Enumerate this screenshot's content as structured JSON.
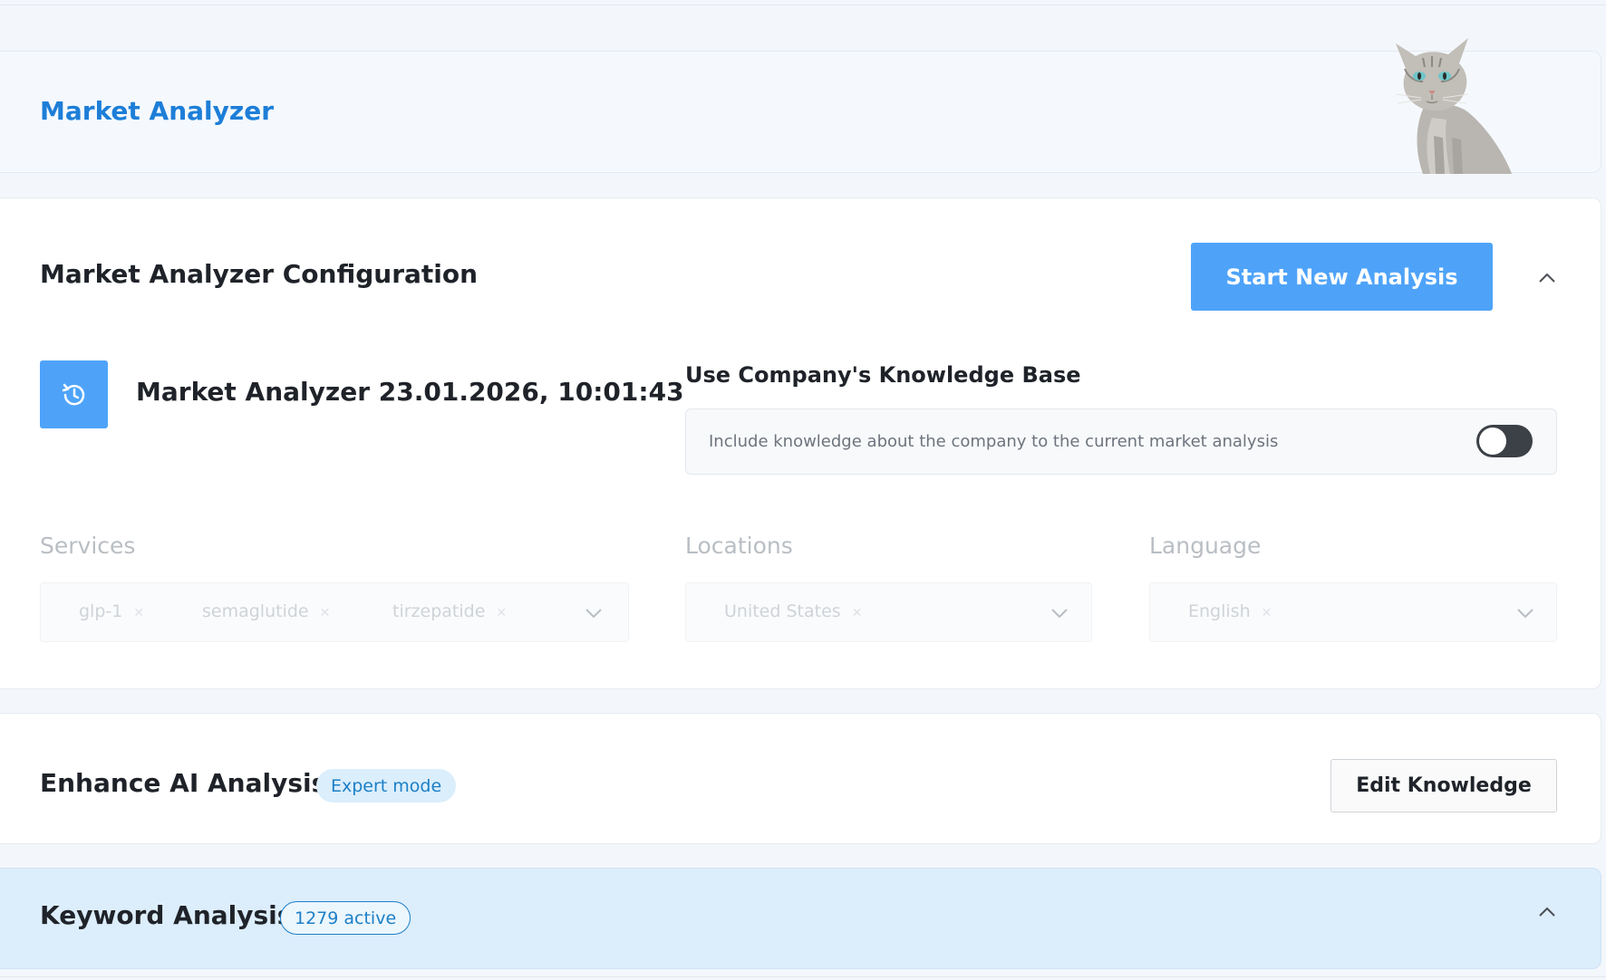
{
  "header": {
    "title": "Market Analyzer"
  },
  "config": {
    "title": "Market Analyzer Configuration",
    "start_button": "Start New Analysis",
    "analysis_name": "Market Analyzer 23.01.2026, 10:01:43",
    "knowledge_base": {
      "title": "Use Company's Knowledge Base",
      "description": "Include knowledge about the company to the current market analysis",
      "enabled": false
    },
    "services": {
      "label": "Services",
      "tags": [
        "glp-1",
        "semaglutide",
        "tirzepatide"
      ]
    },
    "locations": {
      "label": "Locations",
      "tags": [
        "United States"
      ]
    },
    "language": {
      "label": "Language",
      "tags": [
        "English"
      ]
    }
  },
  "enhance": {
    "title": "Enhance AI Analysis",
    "badge": "Expert mode",
    "edit_button": "Edit Knowledge"
  },
  "keyword": {
    "title": "Keyword Analysis",
    "badge": "1279 active"
  },
  "colors": {
    "accent": "#4ea3f9",
    "title_blue": "#1d7ed8",
    "keyword_bg": "#dcedfb"
  }
}
